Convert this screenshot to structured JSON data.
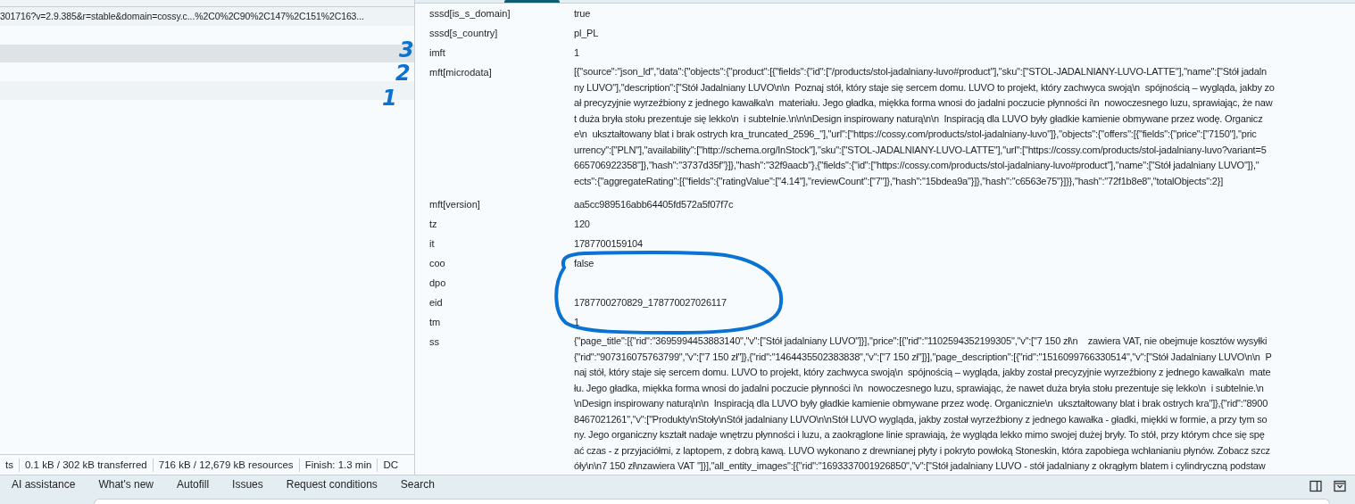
{
  "network": {
    "requests": [
      {
        "name": "301716?v=2.9.385&r=stable&domain=cossy.c...%2C0%2C90%2C147%2C151%2C163...",
        "selected": false
      },
      {
        "selected": false
      },
      {
        "selected": true
      },
      {
        "selected": false
      },
      {
        "selected": false
      }
    ],
    "status_bar": [
      "ts",
      "0.1 kB / 302 kB transferred",
      "716 kB / 12,679 kB resources",
      "Finish: 1.3 min",
      "DC"
    ]
  },
  "payload": {
    "params": [
      {
        "key": "sssd[is_s_domain]",
        "value": "true"
      },
      {
        "key": "sssd[s_country]",
        "value": "pl_PL"
      },
      {
        "key": "imft",
        "value": "1"
      },
      {
        "key": "mft[microdata]",
        "lines": [
          "[{\"source\":\"json_ld\",\"data\":{\"objects\":{\"product\":[{\"fields\":{\"id\":[\"/products/stol-jadalniany-luvo#product\"],\"sku\":[\"STOL-JADALNIANY-LUVO-LATTE\"],\"name\":[\"Stół jadaln",
          "ny LUVO\"],\"description\":[\"Stół Jadalniany LUVO\\n\\n  Poznaj stół, który staje się sercem domu. LUVO to projekt, który zachwyca swoją\\n  spójnością – wygląda, jakby zo",
          "ał precyzyjnie wyrzeźbiony z jednego kawałka\\n  materiału. Jego gładka, miękka forma wnosi do jadalni poczucie płynności i\\n  nowoczesnego luzu, sprawiając, że naw",
          "t duża bryła stołu prezentuje się lekko\\n  i subtelnie.\\n\\n\\nDesign inspirowany naturą\\n\\n  Inspiracją dla LUVO były gładkie kamienie obmywane przez wodę. Organicz",
          "e\\n  ukształtowany blat i brak ostrych kra_truncated_2596_\"],\"url\":[\"https://cossy.com/products/stol-jadalniany-luvo\"]},\"objects\":{\"offers\":[{\"fields\":{\"price\":[\"7150\"],\"pric",
          "urrency\":[\"PLN\"],\"availability\":[\"http://schema.org/InStock\"],\"sku\":[\"STOL-JADALNIANY-LUVO-LATTE\"],\"url\":[\"https://cossy.com/products/stol-jadalniany-luvo?variant=5",
          "665706922358\"]},\"hash\":\"3737d35f\"}]},\"hash\":\"32f9aacb\"},{\"fields\":{\"id\":[\"https://cossy.com/products/stol-jadalniany-luvo#product\"],\"name\":[\"Stół jadalniany LUVO\"]},\"",
          "ects\":{\"aggregateRating\":[{\"fields\":{\"ratingValue\":[\"4.14\"],\"reviewCount\":[\"7\"]},\"hash\":\"15bdea9a\"}]},\"hash\":\"c6563e75\"}]}},\"hash\":\"72f1b8e8\",\"totalObjects\":2}]"
        ]
      },
      {
        "key": "mft[version]",
        "value": "aa5cc989516abb64405fd572a5f07f7c"
      },
      {
        "key": "tz",
        "value": "120"
      },
      {
        "key": "it",
        "value": "1787700159104"
      },
      {
        "key": "coo",
        "value": "false"
      },
      {
        "key": "dpo"
      },
      {
        "key": "eid",
        "value": "1787700270829_178770027026117"
      },
      {
        "key": "tm",
        "value": "1"
      },
      {
        "key": "ss",
        "lines": [
          "{\"page_title\":[{\"rid\":\"3695994453883140\",\"v\":[\"Stół jadalniany LUVO\"]}],\"price\":[{\"rid\":\"1102594352199305\",\"v\":[\"7 150 zł\\n    zawiera VAT, nie obejmuje kosztów wysyłki",
          "{\"rid\":\"907316075763799\",\"v\":[\"7 150 zł\"]},{\"rid\":\"1464435502383838\",\"v\":[\"7 150 zł\"]}],\"page_description\":[{\"rid\":\"1516099766330514\",\"v\":[\"Stół Jadalniany LUVO\\n\\n  P",
          "naj stół, który staje się sercem domu. LUVO to projekt, który zachwyca swoją\\n  spójnością – wygląda, jakby został precyzyjnie wyrzeźbiony z jednego kawałka\\n  mate",
          "łu. Jego gładka, miękka forma wnosi do jadalni poczucie płynności i\\n  nowoczesnego luzu, sprawiając, że nawet duża bryła stołu prezentuje się lekko\\n  i subtelnie.\\n",
          "\\nDesign inspirowany naturą\\n\\n  Inspiracją dla LUVO były gładkie kamienie obmywane przez wodę. Organicznie\\n  ukształtowany blat i brak ostrych kra\"]},{\"rid\":\"8900",
          "8467021261\",\"v\":[\"Produkty\\nStoły\\nStół jadalniany LUVO\\n\\nStół LUVO wygląda, jakby został wyrzeźbiony z jednego kawałka - gładki, miękki w formie, a przy tym so",
          "ny. Jego organiczny kształt nadaje wnętrzu płynności i luzu, a zaokrąglone linie sprawiają, że wygląda lekko mimo swojej dużej bryły. To stół, przy którym chce się spę",
          "ać czas - z przyjaciółmi, z laptopem, z dobrą kawą. LUVO wykonano z drewnianej płyty i pokryto powłoką Stoneskin, która zapobiega wchłanianiu płynów. Zobacz szcz",
          "óły\\n\\n7 150 zł\\nzawiera VAT \"]}],\"all_entity_images\":[{\"rid\":\"1693337001926850\",\"v\":[\"Stół jadalniany LUVO - stół jadalniany z okrągłym blatem i cylindryczną podstaw"
        ]
      }
    ]
  },
  "drawer": {
    "tabs": [
      {
        "label": "AI assistance",
        "selected": false
      },
      {
        "label": "What's new",
        "selected": false
      },
      {
        "label": "Autofill",
        "selected": false
      },
      {
        "label": "Issues",
        "selected": false
      },
      {
        "label": "Request conditions",
        "selected": false
      },
      {
        "label": "Search",
        "selected": false
      }
    ]
  },
  "annotations": {
    "marks": [
      "3",
      "2",
      "1"
    ]
  }
}
